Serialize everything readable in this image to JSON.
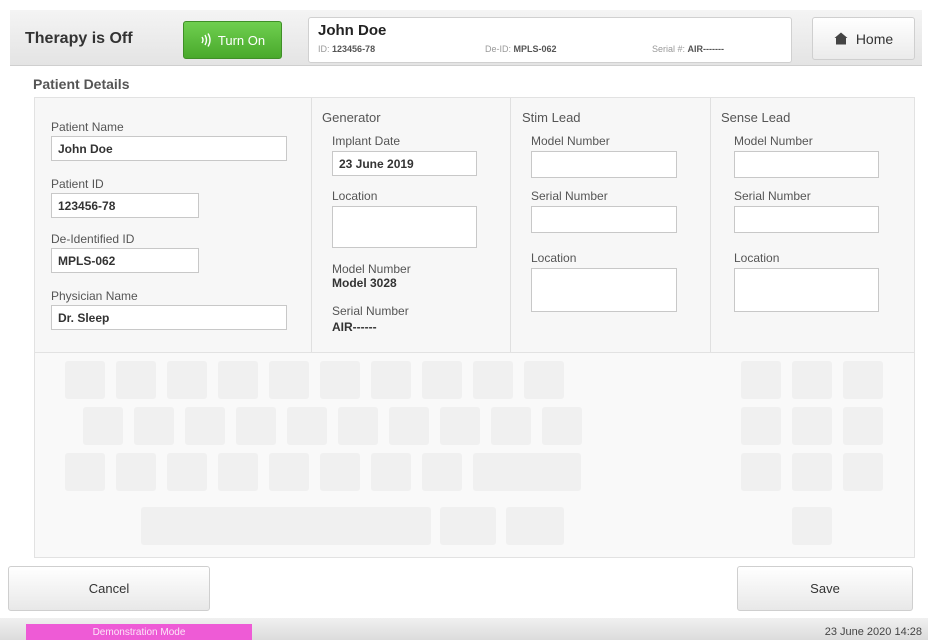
{
  "header": {
    "therapy_status": "Therapy is Off",
    "turn_on_label": "Turn On",
    "home_label": "Home"
  },
  "patient_card": {
    "name": "John Doe",
    "id_label": "ID:",
    "id_value": "123456-78",
    "deid_label": "De-ID:",
    "deid_value": "MPLS-062",
    "serial_label": "Serial #:",
    "serial_value": "AIR-------"
  },
  "section_title": "Patient Details",
  "patient": {
    "name_label": "Patient Name",
    "name_value": "John Doe",
    "id_label": "Patient ID",
    "id_value": "123456-78",
    "deid_label": "De-Identified ID",
    "deid_value": "MPLS-062",
    "physician_label": "Physician Name",
    "physician_value": "Dr. Sleep"
  },
  "generator": {
    "heading": "Generator",
    "implant_date_label": "Implant Date",
    "implant_date_value": "23 June 2019",
    "location_label": "Location",
    "location_value": "",
    "model_label": "Model Number",
    "model_value": "Model 3028",
    "serial_label": "Serial Number",
    "serial_value": "AIR------"
  },
  "stim_lead": {
    "heading": "Stim Lead",
    "model_label": "Model Number",
    "model_value": "",
    "serial_label": "Serial Number",
    "serial_value": "",
    "location_label": "Location",
    "location_value": ""
  },
  "sense_lead": {
    "heading": "Sense Lead",
    "model_label": "Model Number",
    "model_value": "",
    "serial_label": "Serial Number",
    "serial_value": "",
    "location_label": "Location",
    "location_value": ""
  },
  "actions": {
    "cancel_label": "Cancel",
    "save_label": "Save"
  },
  "footer": {
    "mode_label": "Demonstration Mode",
    "timestamp": "23 June 2020 14:28"
  },
  "colors": {
    "turn_on_green": "#52b334",
    "demo_pink": "#ee5bd6"
  },
  "icons": {
    "turn_on": "signal-waves-icon",
    "home": "home-icon"
  }
}
